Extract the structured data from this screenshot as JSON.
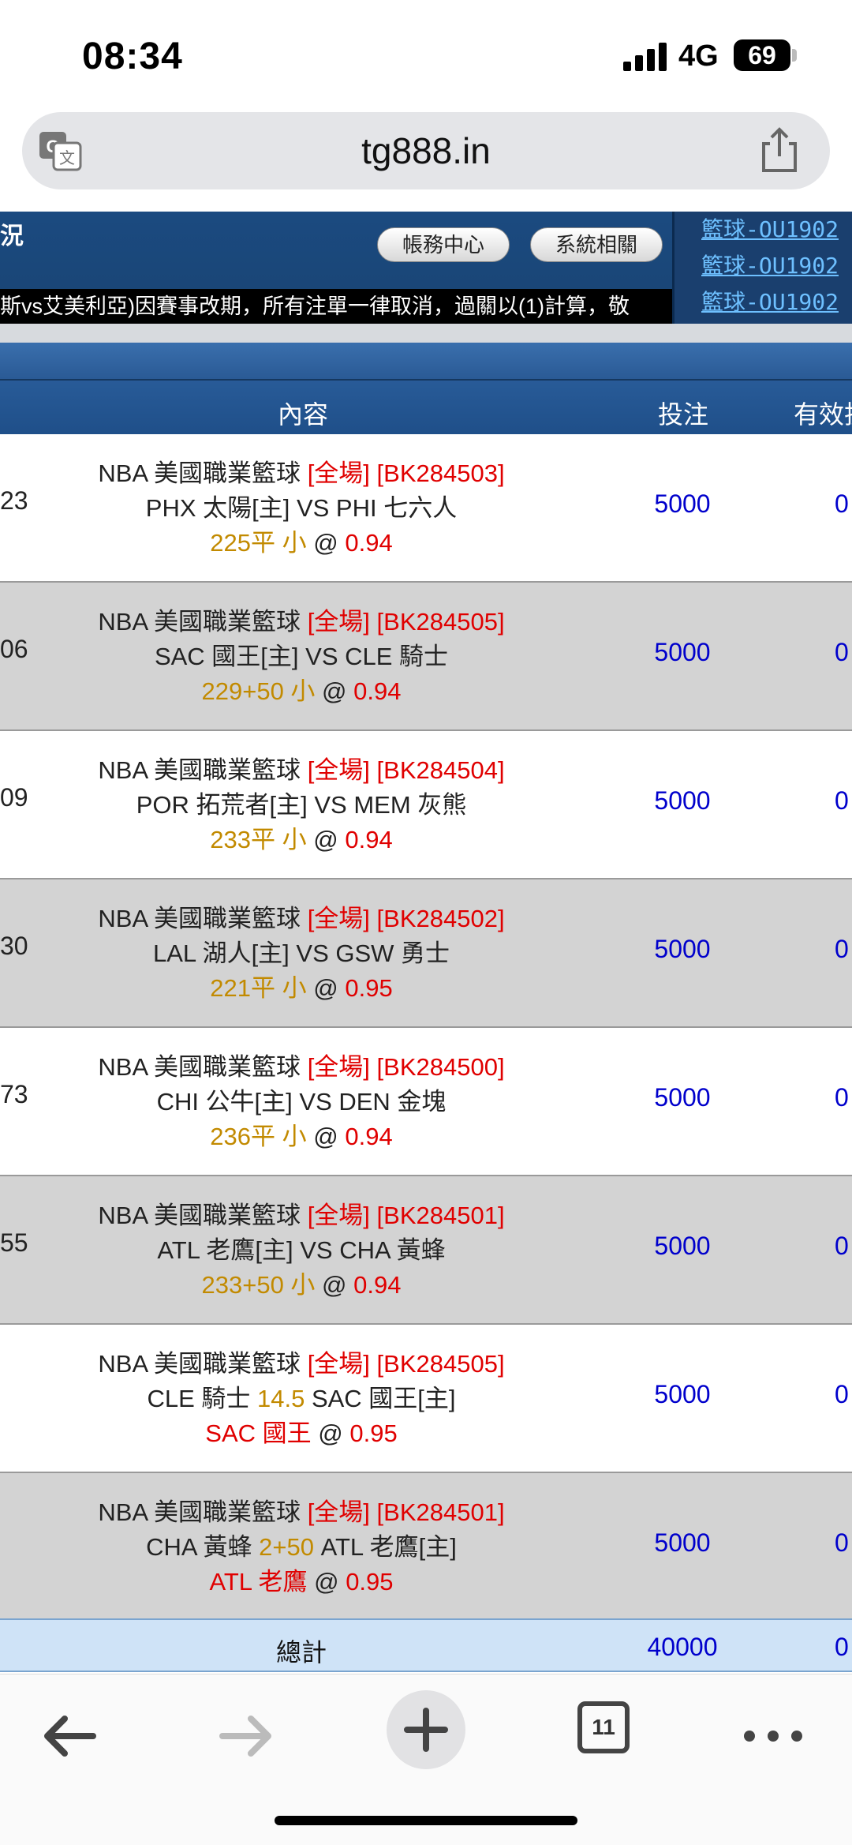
{
  "status_bar": {
    "time": "08:34",
    "network": "4G",
    "battery": "69"
  },
  "browser": {
    "url": "tg888.in",
    "tab_count": "11"
  },
  "header": {
    "left_text": "況",
    "account_button": "帳務中心",
    "system_button": "系統相關",
    "ticker": "斯vs艾美利亞)因賽事改期，所有注單一律取消，過關以(1)計算，敬",
    "side_links": [
      "籃球-OU1902",
      "籃球-OU1902",
      "籃球-OU1902"
    ]
  },
  "table": {
    "columns": {
      "content": "內容",
      "stake": "投注",
      "valid": "有效投"
    },
    "rows": [
      {
        "left": "23",
        "league": "NBA 美國職業籃球",
        "period": "[全場]",
        "code": "[BK284503]",
        "match": [
          "PHX 太陽[主] VS PHI 七六人"
        ],
        "pick_gold": "225平 小",
        "pick_red": "",
        "odds": "0.94",
        "stake": "5000",
        "valid": "0"
      },
      {
        "left": "06",
        "league": "NBA 美國職業籃球",
        "period": "[全場]",
        "code": "[BK284505]",
        "match": [
          "SAC 國王[主] VS CLE 騎士"
        ],
        "pick_gold": "229+50 小",
        "pick_red": "",
        "odds": "0.94",
        "stake": "5000",
        "valid": "0"
      },
      {
        "left": "09",
        "league": "NBA 美國職業籃球",
        "period": "[全場]",
        "code": "[BK284504]",
        "match": [
          "POR 拓荒者[主] VS MEM 灰熊"
        ],
        "pick_gold": "233平 小",
        "pick_red": "",
        "odds": "0.94",
        "stake": "5000",
        "valid": "0"
      },
      {
        "left": "30",
        "league": "NBA 美國職業籃球",
        "period": "[全場]",
        "code": "[BK284502]",
        "match": [
          "LAL 湖人[主] VS GSW 勇士"
        ],
        "pick_gold": "221平 小",
        "pick_red": "",
        "odds": "0.95",
        "stake": "5000",
        "valid": "0"
      },
      {
        "left": "73",
        "league": "NBA 美國職業籃球",
        "period": "[全場]",
        "code": "[BK284500]",
        "match": [
          "CHI 公牛[主] VS DEN 金塊"
        ],
        "pick_gold": "236平 小",
        "pick_red": "",
        "odds": "0.94",
        "stake": "5000",
        "valid": "0"
      },
      {
        "left": "55",
        "league": "NBA 美國職業籃球",
        "period": "[全場]",
        "code": "[BK284501]",
        "match": [
          "ATL 老鷹[主] VS CHA 黃蜂"
        ],
        "pick_gold": "233+50 小",
        "pick_red": "",
        "odds": "0.94",
        "stake": "5000",
        "valid": "0"
      },
      {
        "left": "",
        "league": "NBA 美國職業籃球",
        "period": "[全場]",
        "code": "[BK284505]",
        "match": [
          "CLE 騎士",
          "14.5",
          "SAC 國王[主]"
        ],
        "pick_gold": "",
        "pick_red": "SAC 國王",
        "odds": "0.95",
        "stake": "5000",
        "valid": "0"
      },
      {
        "left": "",
        "league": "NBA 美國職業籃球",
        "period": "[全場]",
        "code": "[BK284501]",
        "match": [
          "CHA 黃蜂",
          "2+50",
          "ATL 老鷹[主]"
        ],
        "pick_gold": "",
        "pick_red": "ATL 老鷹",
        "odds": "0.95",
        "stake": "5000",
        "valid": "0"
      }
    ],
    "total": {
      "label": "總計",
      "stake": "40000",
      "valid": "0"
    }
  },
  "colors": {
    "header_bg": "#1b4a80",
    "odds_red": "#e00000",
    "handicap_gold": "#c28a00",
    "stake_blue": "#0000cc",
    "total_bg": "#cfe3f7"
  }
}
